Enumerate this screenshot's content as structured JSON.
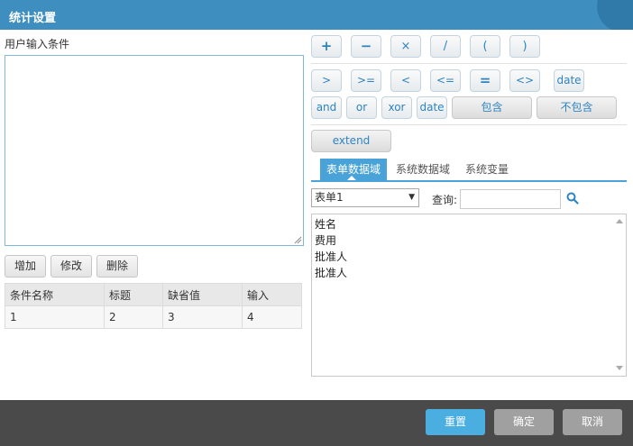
{
  "dialog": {
    "title": "统计设置"
  },
  "condition": {
    "label": "用户输入条件",
    "value": "",
    "buttons": {
      "add": "增加",
      "edit": "修改",
      "delete": "删除"
    },
    "table": {
      "headers": [
        "条件名称",
        "标题",
        "缺省值",
        "输入"
      ],
      "rows": [
        [
          "1",
          "2",
          "3",
          "4"
        ]
      ]
    }
  },
  "operators": {
    "row1": [
      "+",
      "−",
      "×",
      "/",
      "(",
      ")"
    ],
    "row2": [
      ">",
      ">=",
      "<",
      "<=",
      "=",
      "<>",
      "date"
    ],
    "row3": [
      "and",
      "or",
      "xor",
      "date",
      "包含",
      "不包含"
    ],
    "extend": "extend"
  },
  "tabs": [
    "表单数据域",
    "系统数据域",
    "系统变量"
  ],
  "form_select": {
    "selected": "表单1"
  },
  "query": {
    "label": "查询:",
    "value": ""
  },
  "fields": [
    "姓名",
    "费用",
    "批准人",
    "批准人"
  ],
  "footer": {
    "reset": "重置",
    "ok": "确定",
    "cancel": "取消"
  },
  "colors": {
    "header": "#3e8fbf",
    "accent": "#4aa3d8",
    "footer": "#4a4a4a"
  }
}
